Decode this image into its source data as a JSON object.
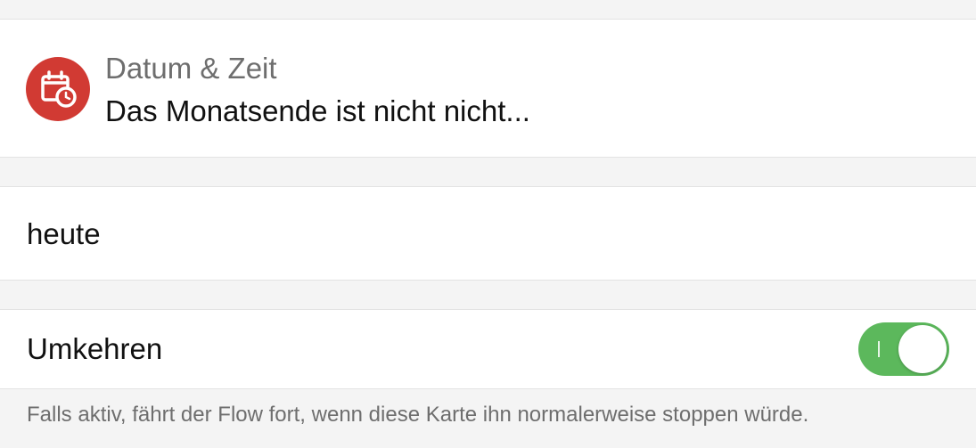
{
  "card": {
    "icon": "calendar-clock-icon",
    "icon_color": "#d13a33",
    "title": "Datum & Zeit",
    "subtitle": "Das Monatsende ist nicht nicht..."
  },
  "date_argument": {
    "value": "heute"
  },
  "reverse": {
    "label": "Umkehren",
    "enabled": true,
    "toggle_color": "#5cb85c",
    "toggle_on_mark": "I"
  },
  "footnote": "Falls aktiv, fährt der Flow fort, wenn diese Karte ihn normalerweise stoppen würde."
}
